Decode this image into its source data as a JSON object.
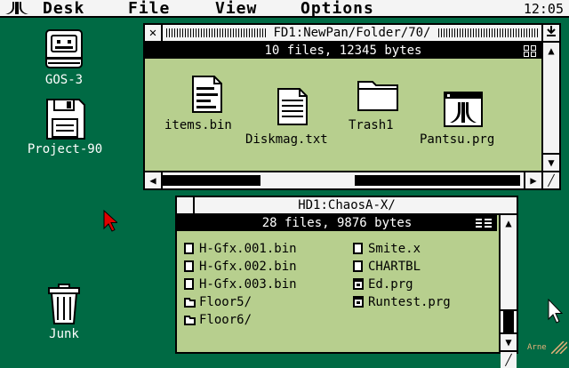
{
  "menubar": {
    "logo_icon": "atari-logo-icon",
    "items": [
      "Desk",
      "File",
      "View",
      "Options"
    ],
    "clock": "12:05"
  },
  "desktop_icons": [
    {
      "label": "GOS-3",
      "icon": "drive-icon"
    },
    {
      "label": "Project-90",
      "icon": "floppy-disk-icon"
    },
    {
      "label": "Junk",
      "icon": "trash-can-icon"
    }
  ],
  "window1": {
    "title": "FD1:NewPan/Folder/70/",
    "info": "10 files, 12345 bytes",
    "items": [
      {
        "label": "items.bin",
        "icon": "document-icon"
      },
      {
        "label": "Diskmag.txt",
        "icon": "text-document-icon"
      },
      {
        "label": "Trash1",
        "icon": "folder-icon"
      },
      {
        "label": "Pantsu.prg",
        "icon": "program-icon"
      }
    ]
  },
  "window2": {
    "title": "HD1:ChaosA-X/",
    "info": "28 files, 9876 bytes",
    "col1": [
      {
        "label": "H-Gfx.001.bin",
        "icon": "file-icon"
      },
      {
        "label": "H-Gfx.002.bin",
        "icon": "file-icon"
      },
      {
        "label": "H-Gfx.003.bin",
        "icon": "file-icon"
      },
      {
        "label": "Floor5/",
        "icon": "folder-icon"
      },
      {
        "label": "Floor6/",
        "icon": "folder-icon"
      }
    ],
    "col2": [
      {
        "label": "Smite.x",
        "icon": "file-icon"
      },
      {
        "label": "CHARTBL",
        "icon": "file-icon"
      },
      {
        "label": "Ed.prg",
        "icon": "program-icon"
      },
      {
        "label": "Runtest.prg",
        "icon": "program-icon"
      }
    ]
  },
  "signature": "Arne",
  "colors": {
    "desktop": "#006a44",
    "window_bg": "#b7cf8e",
    "cursor_red": "#e00000"
  }
}
